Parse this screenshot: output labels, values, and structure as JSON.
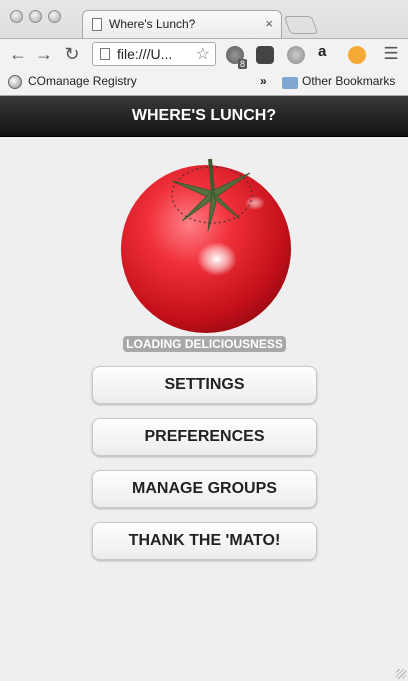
{
  "browser": {
    "tab_title": "Where's Lunch?",
    "tab_close": "×",
    "url": "file:///U...",
    "extension_badge": "8",
    "bookmarks": {
      "item_1": "COmanage Registry",
      "overflow": "»",
      "other": "Other Bookmarks"
    }
  },
  "app": {
    "title": "WHERE'S LUNCH?",
    "loading_text": "LOADING DELICIOUSNESS",
    "buttons": {
      "settings": "SETTINGS",
      "preferences": "PREFERENCES",
      "manage_groups": "MANAGE GROUPS",
      "thank": "THANK THE 'MATO!"
    },
    "colors": {
      "header": "#1c1c1c",
      "tomato": "#e0242b",
      "leaf": "#4d6b3a"
    }
  }
}
